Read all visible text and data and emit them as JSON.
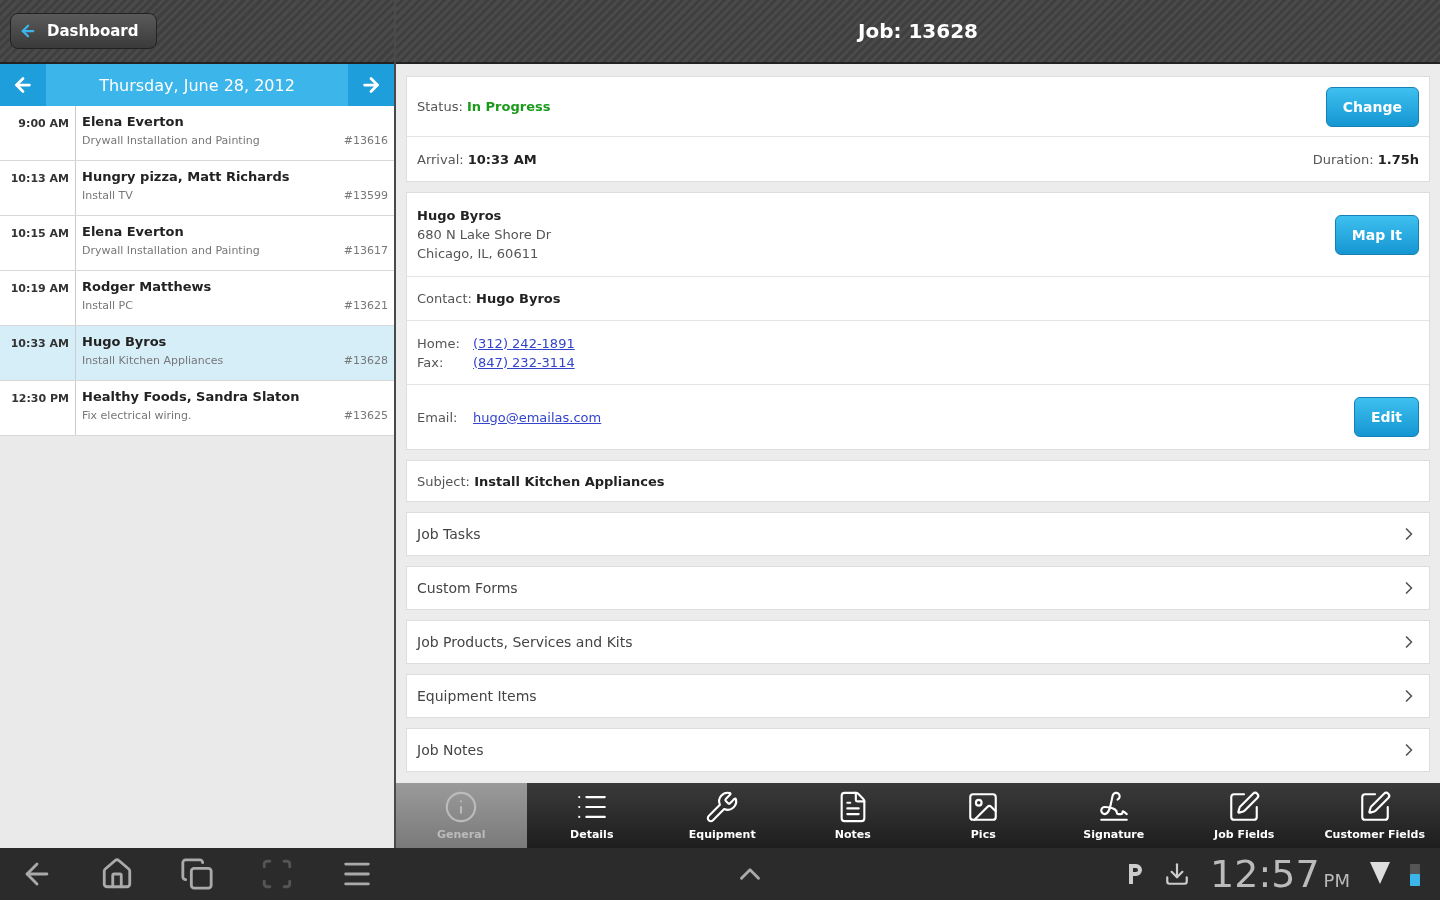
{
  "header": {
    "back_button": "Dashboard",
    "title": "Job: 13628"
  },
  "schedule": {
    "date": "Thursday, June 28, 2012",
    "jobs": [
      {
        "time": "9:00 AM",
        "name": "Elena Everton",
        "subject": "Drywall Installation and Painting",
        "number": "#13616",
        "selected": false
      },
      {
        "time": "10:13 AM",
        "name": "Hungry pizza, Matt Richards",
        "subject": "Install TV",
        "number": "#13599",
        "selected": false
      },
      {
        "time": "10:15 AM",
        "name": "Elena Everton",
        "subject": "Drywall Installation and Painting",
        "number": "#13617",
        "selected": false
      },
      {
        "time": "10:19 AM",
        "name": "Rodger Matthews",
        "subject": "Install PC",
        "number": "#13621",
        "selected": false
      },
      {
        "time": "10:33 AM",
        "name": "Hugo Byros",
        "subject": "Install Kitchen Appliances",
        "number": "#13628",
        "selected": true
      },
      {
        "time": "12:30 PM",
        "name": "Healthy Foods, Sandra Slaton",
        "subject": "Fix electrical wiring.",
        "number": "#13625",
        "selected": false
      }
    ]
  },
  "job": {
    "status": {
      "label": "Status:",
      "value": "In Progress",
      "button": "Change"
    },
    "arrival": {
      "label": "Arrival:",
      "value": "10:33 AM"
    },
    "duration": {
      "label": "Duration:",
      "value": "1.75h"
    },
    "customer": {
      "name": "Hugo Byros",
      "address_lines": [
        "680 N Lake Shore Dr",
        "Chicago, IL, 60611"
      ],
      "button": "Map It"
    },
    "contact": {
      "label": "Contact:",
      "value": "Hugo Byros"
    },
    "phones": [
      {
        "label": "Home:",
        "value": "(312) 242-1891"
      },
      {
        "label": "Fax:",
        "value": "(847) 232-3114"
      }
    ],
    "email": {
      "label": "Email:",
      "value": "hugo@emailas.com",
      "button": "Edit"
    },
    "subject": {
      "label": "Subject:",
      "value": "Install Kitchen Appliances"
    },
    "sections": [
      "Job Tasks",
      "Custom Forms",
      "Job Products, Services and Kits",
      "Equipment Items",
      "Job Notes"
    ]
  },
  "tabs": [
    {
      "label": "General",
      "selected": true
    },
    {
      "label": "Details",
      "selected": false
    },
    {
      "label": "Equipment",
      "selected": false
    },
    {
      "label": "Notes",
      "selected": false
    },
    {
      "label": "Pics",
      "selected": false
    },
    {
      "label": "Signature",
      "selected": false
    },
    {
      "label": "Job Fields",
      "selected": false
    },
    {
      "label": "Customer Fields",
      "selected": false
    }
  ],
  "system_bar": {
    "time": "12:57",
    "period": "PM"
  }
}
